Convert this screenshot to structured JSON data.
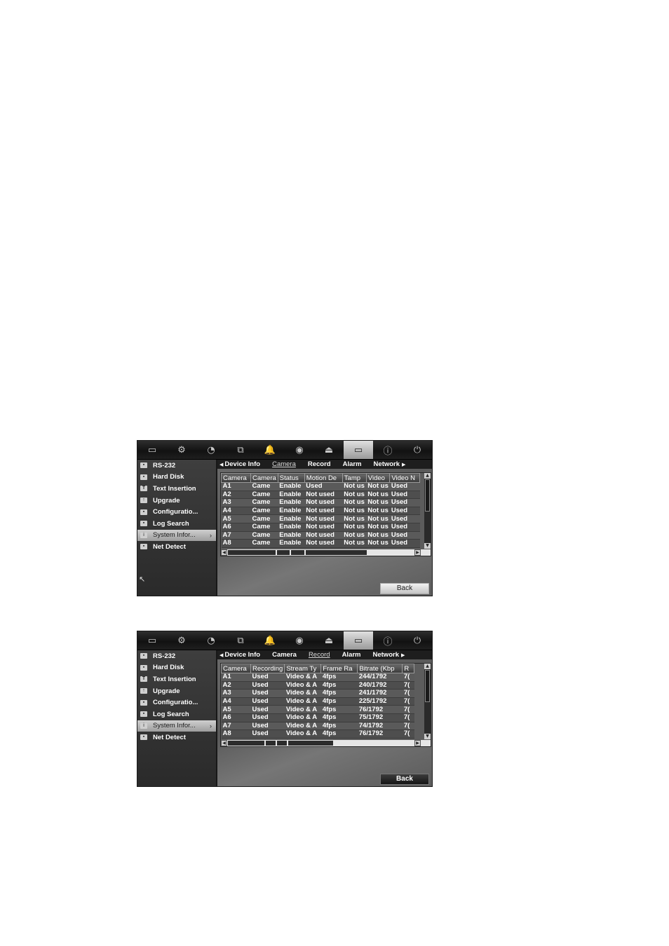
{
  "topbar_icons": [
    "monitor-icon",
    "camera-icon",
    "clock-icon",
    "network-icon",
    "alarm-bell-icon",
    "ptz-dome-icon",
    "user-icon",
    "device-icon",
    "info-icon",
    "power-icon"
  ],
  "topbar_glyphs": [
    "▭",
    "⚙",
    "◔",
    "⧉",
    "🔔",
    "◉",
    "⏏",
    "▭",
    "ⓘ",
    "⏻"
  ],
  "sidebar": {
    "items": [
      {
        "label": "RS-232",
        "glyph": "▪"
      },
      {
        "label": "Hard Disk",
        "glyph": "▪"
      },
      {
        "label": "Text Insertion",
        "glyph": "T"
      },
      {
        "label": "Upgrade",
        "glyph": "↑"
      },
      {
        "label": "Configuratio...",
        "glyph": "▪"
      },
      {
        "label": "Log Search",
        "glyph": "▪"
      },
      {
        "label": "System Infor...",
        "glyph": "i"
      },
      {
        "label": "Net Detect",
        "glyph": "▪"
      }
    ],
    "chevron": "›"
  },
  "screens": [
    {
      "tabs": [
        "Device Info",
        "Camera",
        "Record",
        "Alarm",
        "Network"
      ],
      "tab_prev": "◀",
      "tab_next": "▶",
      "active_tab": "Camera",
      "columns": [
        "Camera",
        "Camera",
        "Status",
        "Motion De",
        "Tamp",
        "Video",
        "Video N"
      ],
      "rows": [
        [
          "A1",
          "Came",
          "Enable",
          "Used",
          "Not us",
          "Not us",
          "Used"
        ],
        [
          "A2",
          "Came",
          "Enable",
          "Not used",
          "Not us",
          "Not us",
          "Used"
        ],
        [
          "A3",
          "Came",
          "Enable",
          "Not used",
          "Not us",
          "Not us",
          "Used"
        ],
        [
          "A4",
          "Came",
          "Enable",
          "Not used",
          "Not us",
          "Not us",
          "Used"
        ],
        [
          "A5",
          "Came",
          "Enable",
          "Not used",
          "Not us",
          "Not us",
          "Used"
        ],
        [
          "A6",
          "Came",
          "Enable",
          "Not used",
          "Not us",
          "Not us",
          "Used"
        ],
        [
          "A7",
          "Came",
          "Enable",
          "Not used",
          "Not us",
          "Not us",
          "Used"
        ],
        [
          "A8",
          "Came",
          "Enable",
          "Not used",
          "Not us",
          "Not us",
          "Used"
        ]
      ],
      "back_label": "Back"
    },
    {
      "tabs": [
        "Device Info",
        "Camera",
        "Record",
        "Alarm",
        "Network"
      ],
      "tab_prev": "◀",
      "tab_next": "▶",
      "active_tab": "Record",
      "columns": [
        "Camera",
        "Recording",
        "Stream Ty",
        "Frame Ra",
        "Bitrate (Kbp",
        "R"
      ],
      "rows": [
        [
          "A1",
          "Used",
          "Video & A",
          "4fps",
          "244/1792",
          "7("
        ],
        [
          "A2",
          "Used",
          "Video & A",
          "4fps",
          "240/1792",
          "7("
        ],
        [
          "A3",
          "Used",
          "Video & A",
          "4fps",
          "241/1792",
          "7("
        ],
        [
          "A4",
          "Used",
          "Video & A",
          "4fps",
          "225/1792",
          "7("
        ],
        [
          "A5",
          "Used",
          "Video & A",
          "4fps",
          "76/1792",
          "7("
        ],
        [
          "A6",
          "Used",
          "Video & A",
          "4fps",
          "75/1792",
          "7("
        ],
        [
          "A7",
          "Used",
          "Video & A",
          "4fps",
          "74/1792",
          "7("
        ],
        [
          "A8",
          "Used",
          "Video & A",
          "4fps",
          "76/1792",
          "7("
        ]
      ],
      "back_label": "Back"
    }
  ]
}
